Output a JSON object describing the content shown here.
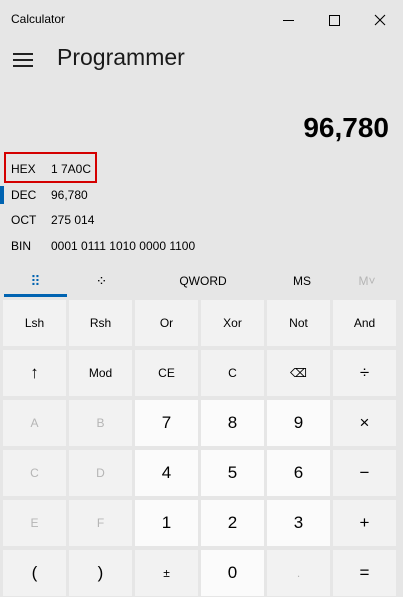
{
  "window": {
    "title": "Calculator",
    "controls": {
      "minimize": "—",
      "maximize": "☐",
      "close": "✕"
    }
  },
  "header": {
    "mode": "Programmer"
  },
  "display": {
    "value": "96,780"
  },
  "radix": [
    {
      "label": "HEX",
      "value": "1 7A0C"
    },
    {
      "label": "DEC",
      "value": "96,780"
    },
    {
      "label": "OCT",
      "value": "275 014"
    },
    {
      "label": "BIN",
      "value": "0001 0111 1010 0000 1100"
    }
  ],
  "tabs": {
    "keypad_icon": "⠿",
    "bitflip_icon": "⁘",
    "word_size": "QWORD",
    "ms": "MS",
    "mplus": "M˅"
  },
  "keys": [
    [
      "Lsh",
      "Rsh",
      "Or",
      "Xor",
      "Not",
      "And"
    ],
    [
      "↑",
      "Mod",
      "CE",
      "C",
      "⌫",
      "÷"
    ],
    [
      "A",
      "B",
      "7",
      "8",
      "9",
      "×"
    ],
    [
      "C",
      "D",
      "4",
      "5",
      "6",
      "−"
    ],
    [
      "E",
      "F",
      "1",
      "2",
      "3",
      "+"
    ],
    [
      "(",
      ")",
      "±",
      "0",
      ".",
      "="
    ]
  ],
  "colors": {
    "accent": "#0063b1",
    "highlight_box": "#d40000",
    "background": "#e6e6e6"
  }
}
